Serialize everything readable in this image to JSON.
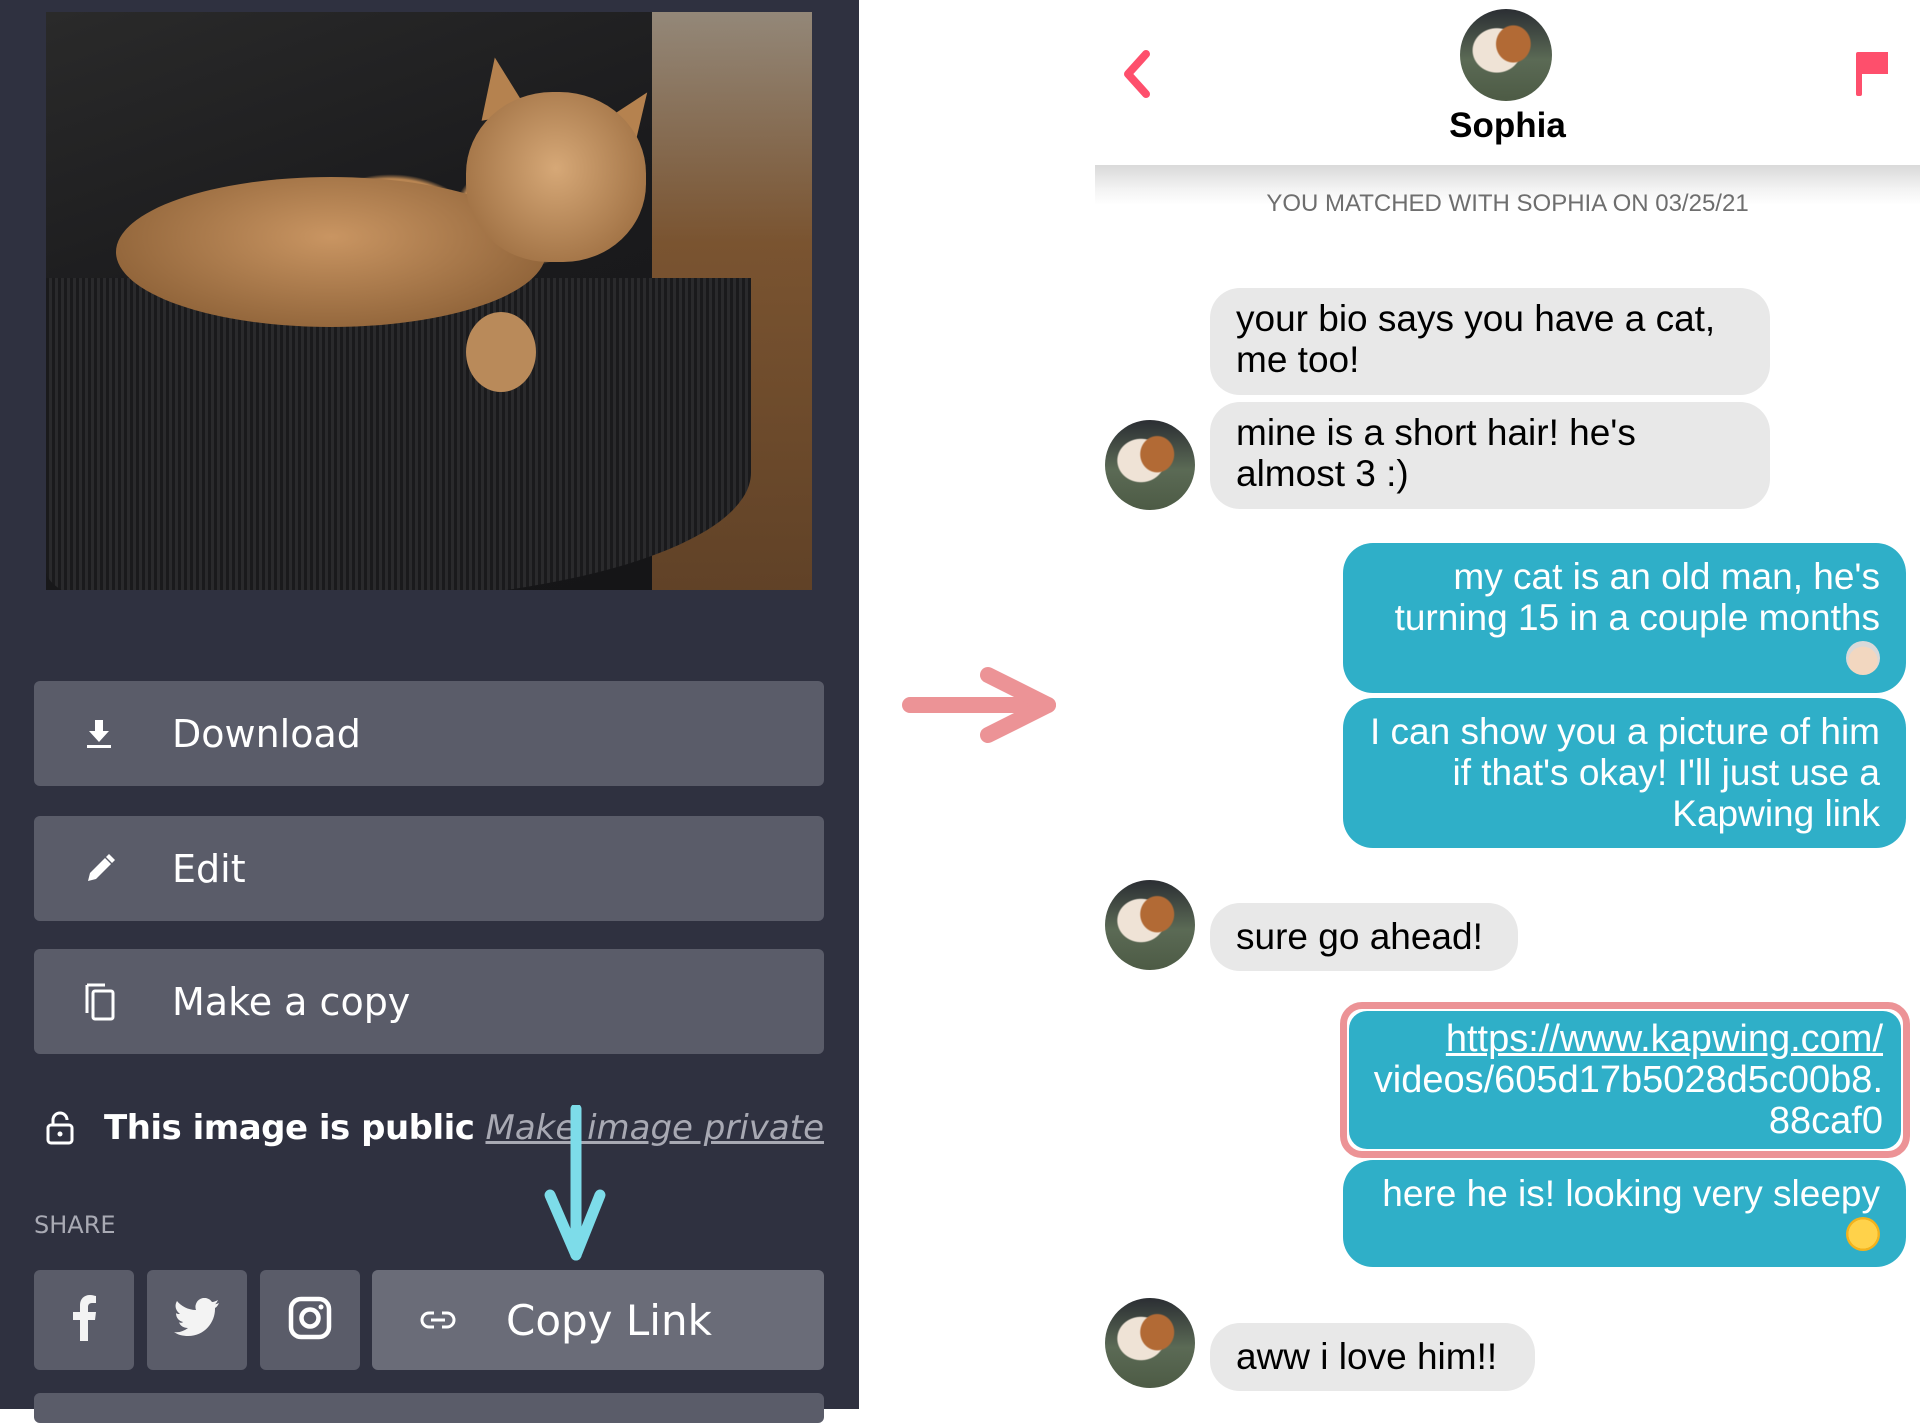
{
  "left_panel": {
    "image_alt": "Orange tabby cat lying on a black mesh office chair",
    "actions": [
      {
        "label": "Download",
        "icon": "download-icon"
      },
      {
        "label": "Edit",
        "icon": "pencil-icon"
      },
      {
        "label": "Make a copy",
        "icon": "copy-icon"
      }
    ],
    "visibility": {
      "status": "This image is public",
      "toggle_link": "Make image private",
      "icon": "unlock-icon"
    },
    "share": {
      "label": "SHARE",
      "buttons": [
        {
          "name": "facebook",
          "icon": "facebook-icon"
        },
        {
          "name": "twitter",
          "icon": "twitter-icon"
        },
        {
          "name": "instagram",
          "icon": "instagram-icon"
        }
      ],
      "copy_link_label": "Copy Link",
      "copy_link_icon": "link-icon"
    }
  },
  "chat": {
    "contact_name": "Sophia",
    "match_note": "YOU MATCHED WITH SOPHIA ON 03/25/21",
    "accent_color": "#fe4f6c",
    "messages": [
      {
        "from": "them",
        "text": "your bio says you have a cat, me too!"
      },
      {
        "from": "them",
        "text": "mine is a short hair! he's almost 3 :)"
      },
      {
        "from": "me",
        "text": "my cat is an old man, he's turning 15 in a couple months",
        "emoji": "older-man-emoji"
      },
      {
        "from": "me",
        "text": "I can show you a picture of him if that's okay! I'll just use a Kapwing link"
      },
      {
        "from": "them",
        "text": "sure go ahead!"
      },
      {
        "from": "me",
        "type": "link",
        "url_line1": "https://www.kapwing.com/",
        "url_line2": "videos/605d17b5028d5c00b8.",
        "url_line3": "88caf0",
        "highlighted": true
      },
      {
        "from": "me",
        "text": "here he is! looking very sleepy",
        "emoji": "sleeping-face-emoji"
      },
      {
        "from": "them",
        "text": "aww i love him!!"
      }
    ]
  },
  "annotations": {
    "copy_link_arrow_color": "#7ddce9",
    "transition_arrow_color": "#ec9396",
    "link_arrow_color": "#7ddce9",
    "highlight_color": "#ec9396"
  }
}
